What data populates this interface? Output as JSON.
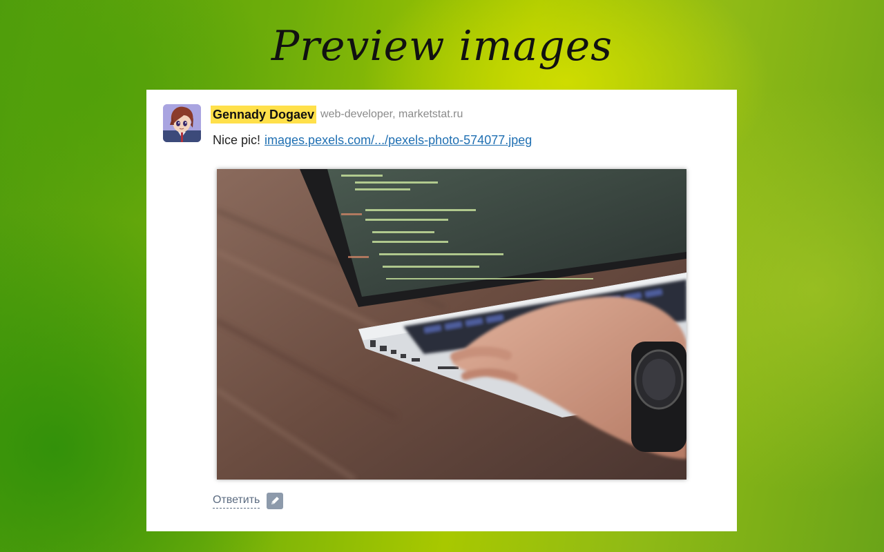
{
  "banner": {
    "title": "Preview images"
  },
  "post": {
    "author_name": "Gennady Dogaev",
    "author_role": "web-developer, marketstat.ru",
    "message_text": "Nice pic!",
    "link_text": "images.pexels.com/.../pexels-photo-574077.jpeg",
    "preview_image_icon": "laptop-photo",
    "avatar_icon": "anime-avatar"
  },
  "actions": {
    "reply_label": "Ответить",
    "edit_icon": "pencil-icon"
  },
  "colors": {
    "name_highlight": "#ffe04a",
    "link": "#1f6fb2",
    "reply": "#5b6b80"
  }
}
